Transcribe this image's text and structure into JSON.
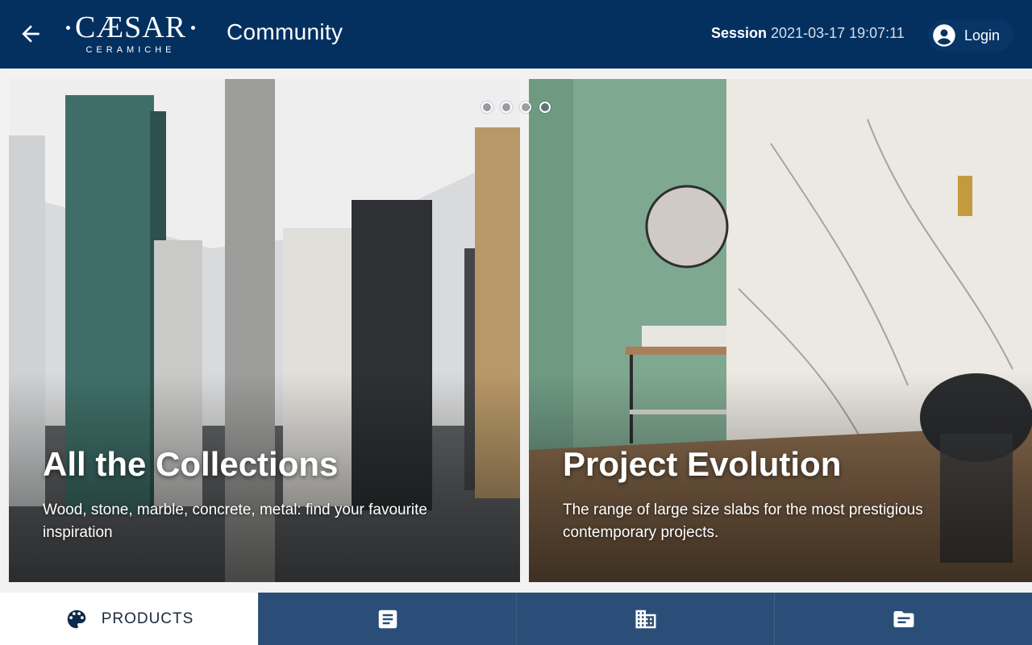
{
  "header": {
    "logo_main": "CÆSAR",
    "logo_sub": "CERAMICHE",
    "title": "Community",
    "session_label": "Session",
    "session_value": "2021-03-17 19:07:11",
    "login_label": "Login",
    "bg_color": "#043060"
  },
  "carousel": {
    "dot_count": 4,
    "cards": [
      {
        "title": "All the Collections",
        "description": "Wood, stone, marble, concrete, metal: find your favourite inspiration"
      },
      {
        "title": "Project Evolution",
        "description": "The range of large size slabs for the most prestigious contemporary projects."
      }
    ]
  },
  "bottom_nav": {
    "items": [
      {
        "label": "PRODUCTS",
        "icon": "palette-icon",
        "active": true
      },
      {
        "label": "",
        "icon": "article-icon",
        "active": false
      },
      {
        "label": "",
        "icon": "building-icon",
        "active": false
      },
      {
        "label": "",
        "icon": "folder-icon",
        "active": false
      }
    ],
    "active_bg": "#ffffff",
    "inactive_bg": "#2a4e78"
  }
}
